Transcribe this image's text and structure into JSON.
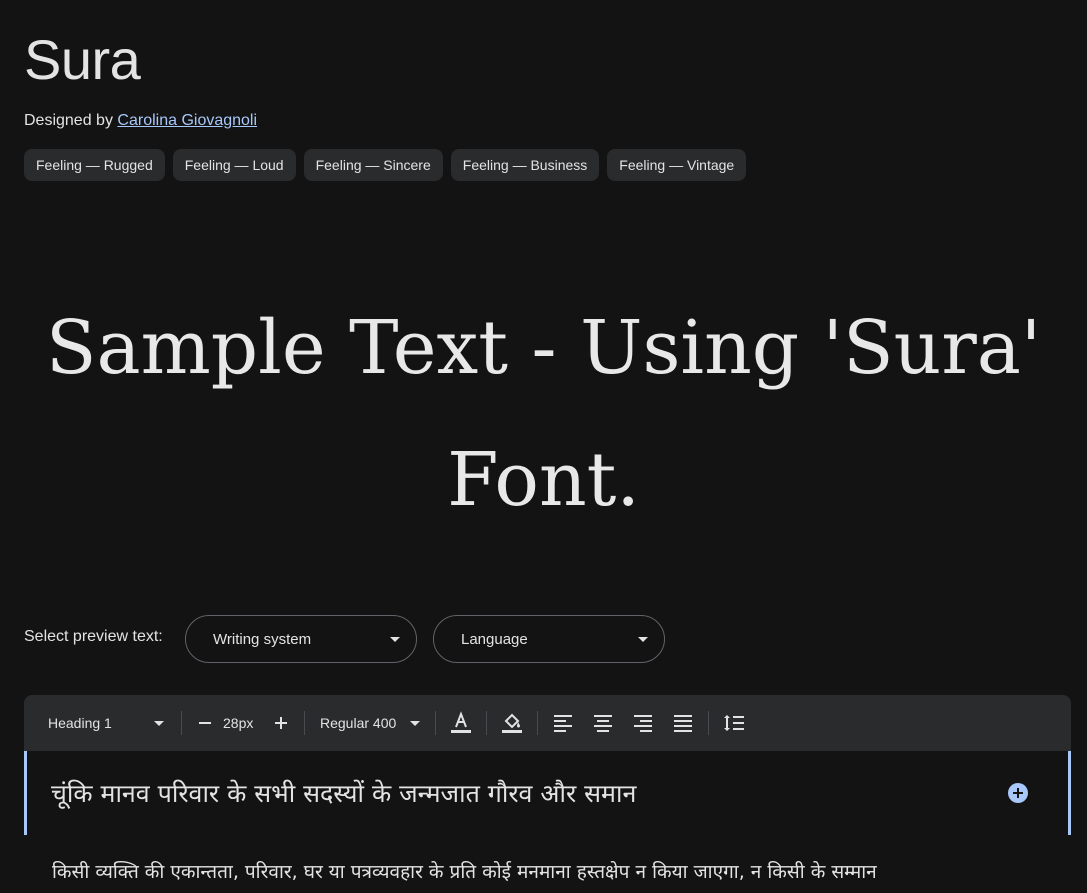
{
  "font": {
    "name": "Sura",
    "designed_by_label": "Designed by",
    "designer": "Carolina Giovagnoli"
  },
  "tags": [
    "Feeling — Rugged",
    "Feeling — Loud",
    "Feeling — Sincere",
    "Feeling — Business",
    "Feeling — Vintage"
  ],
  "sample_text": "Sample Text - Using 'Sura' Font.",
  "preview_controls": {
    "label": "Select preview text:",
    "writing_system": "Writing system",
    "language": "Language"
  },
  "toolbar": {
    "style": "Heading 1",
    "size": "28px",
    "weight": "Regular 400",
    "decrease_icon": "minus-icon",
    "increase_icon": "plus-icon"
  },
  "preview": {
    "heading": "चूंकि मानव परिवार के सभी सदस्यों के जन्मजात गौरव और समान",
    "body": "किसी व्यक्ति की एकान्तता, परिवार, घर या पत्रव्यवहार के प्रति कोई मनमाना हस्तक्षेप न किया जाएगा, न किसी के सम्मान"
  },
  "colors": {
    "background": "#131313",
    "surface": "#2a2b2d",
    "accent": "#a8c7fa",
    "text": "#e3e3e3"
  }
}
